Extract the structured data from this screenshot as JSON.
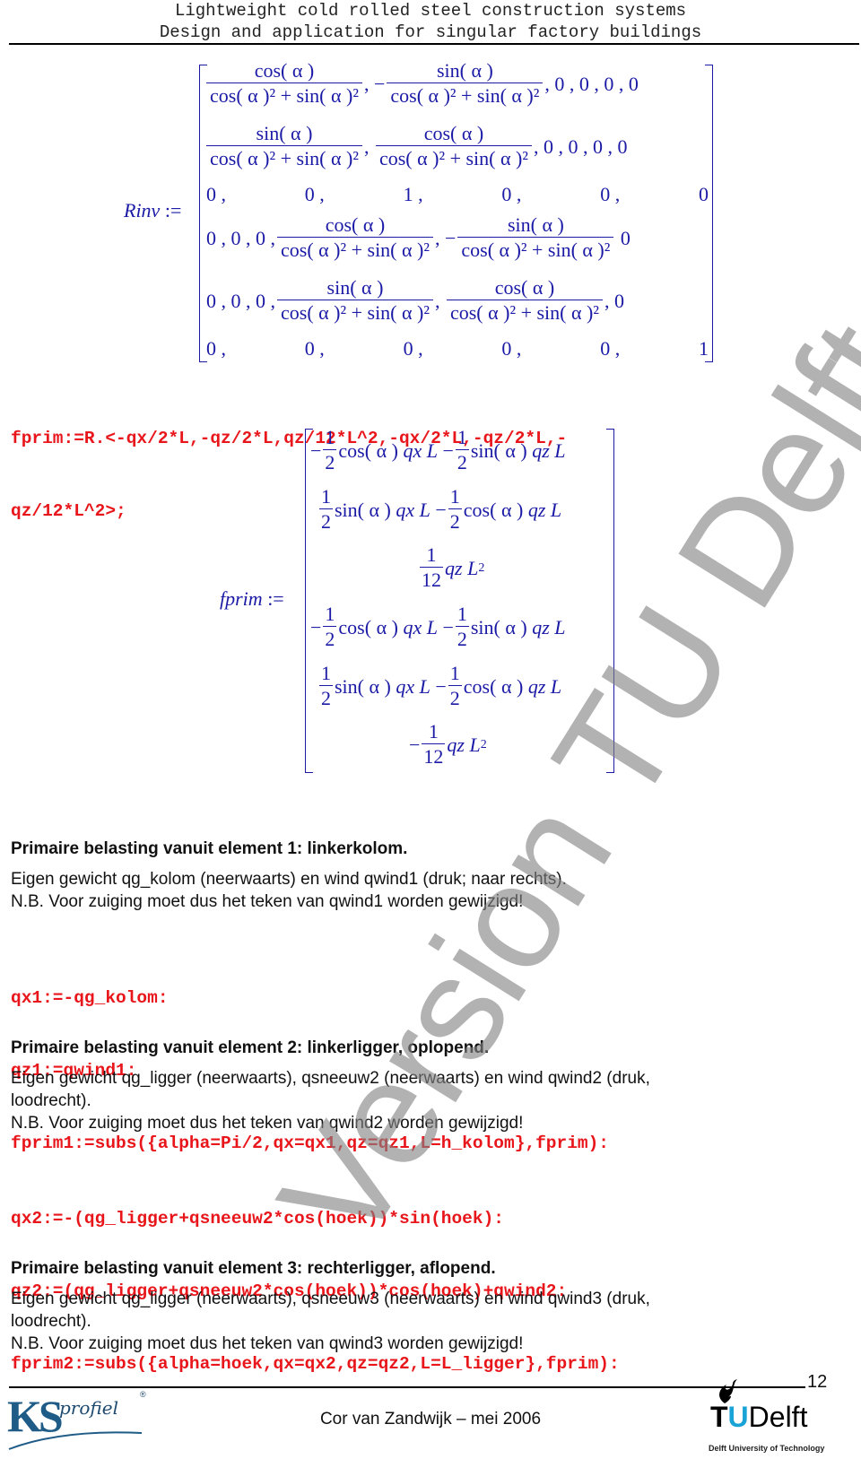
{
  "header": {
    "line1": "Lightweight cold rolled steel construction systems",
    "line2": "Design and application for singular factory buildings"
  },
  "rinv": {
    "label": "Rinv",
    "assign": ":=",
    "cos_num": "cos( α )",
    "sin_num": "sin( α )",
    "den": "cos( α )² + sin( α )²",
    "rows": {
      "r1_tail": ", 0 , 0 , 0 , 0",
      "r2_tail": ", 0 , 0 , 0 , 0",
      "r3": [
        "0 ,",
        "0 ,",
        "1 ,",
        "0 ,",
        "0 ,",
        "0"
      ],
      "r4_head": "0 , 0 , 0 ,",
      "r4_tail": "0",
      "r5_head": "0 , 0 , 0 ,",
      "r5_tail": ", 0",
      "r6": [
        "0 ,",
        "0 ,",
        "0 ,",
        "0 ,",
        "0 ,",
        "1"
      ]
    },
    "minus": "−",
    "comma": ","
  },
  "code1": {
    "line1": "fprim:=R.<-qx/2*L,-qz/2*L,qz/12*L^2,-qx/2*L,-qz/2*L,-",
    "line2": "qz/12*L^2>;"
  },
  "fprim": {
    "label": "fprim",
    "assign": ":=",
    "one": "1",
    "two": "2",
    "twelve": "12",
    "minus": "−",
    "cos_a": "cos( α )",
    "sin_a": "sin( α )",
    "qx": "qx",
    "qz": "qz",
    "L": "L",
    "sq": "2"
  },
  "section1": {
    "title": "Primaire belasting vanuit element 1: linkerkolom.",
    "line1": "Eigen gewicht qg_kolom (neerwaarts) en wind qwind1 (druk; naar rechts).",
    "line2": "N.B. Voor zuiging moet dus het teken van qwind1 worden gewijzigd!",
    "code": [
      "qx1:=-qg_kolom:",
      "qz1:=qwind1:",
      "fprim1:=subs({alpha=Pi/2,qx=qx1,qz=qz1,L=h_kolom},fprim):"
    ]
  },
  "section2": {
    "title": "Primaire belasting vanuit element 2: linkerligger, oplopend.",
    "line1": "Eigen gewicht qg_ligger (neerwaarts), qsneeuw2 (neerwaarts) en wind qwind2 (druk,",
    "line1b": "loodrecht).",
    "line2": "N.B. Voor zuiging moet dus het teken van qwind2 worden gewijzigd!",
    "code": [
      "qx2:=-(qg_ligger+qsneeuw2*cos(hoek))*sin(hoek):",
      "qz2:=(qg_ligger+qsneeuw2*cos(hoek))*cos(hoek)+qwind2:",
      "fprim2:=subs({alpha=hoek,qx=qx2,qz=qz2,L=L_ligger},fprim):"
    ]
  },
  "section3": {
    "title": "Primaire belasting vanuit element 3: rechterligger, aflopend.",
    "line1": "Eigen gewicht qg_ligger (neerwaarts), qsneeuw3 (neerwaarts) en wind qwind3 (druk,",
    "line1b": "loodrecht).",
    "line2": "N.B. Voor zuiging moet dus het teken van qwind3 worden gewijzigd!"
  },
  "footer": {
    "page_number": "12",
    "author": "Cor van Zandwijk –  mei 2006",
    "ks_logo": {
      "ks": "KS",
      "profiel": "profiel",
      "reg": "®"
    },
    "tud_logo": {
      "t": "T",
      "u": "U",
      "delft": "Delft",
      "sub": "Delft University of Technology"
    }
  },
  "watermark": "Version TU Delft",
  "colors": {
    "math": "#1a1aa6",
    "code": "#e8161b",
    "ks_blue": "#1e5b86",
    "tud_blue": "#1aa3d6",
    "watermark": "#828282"
  }
}
